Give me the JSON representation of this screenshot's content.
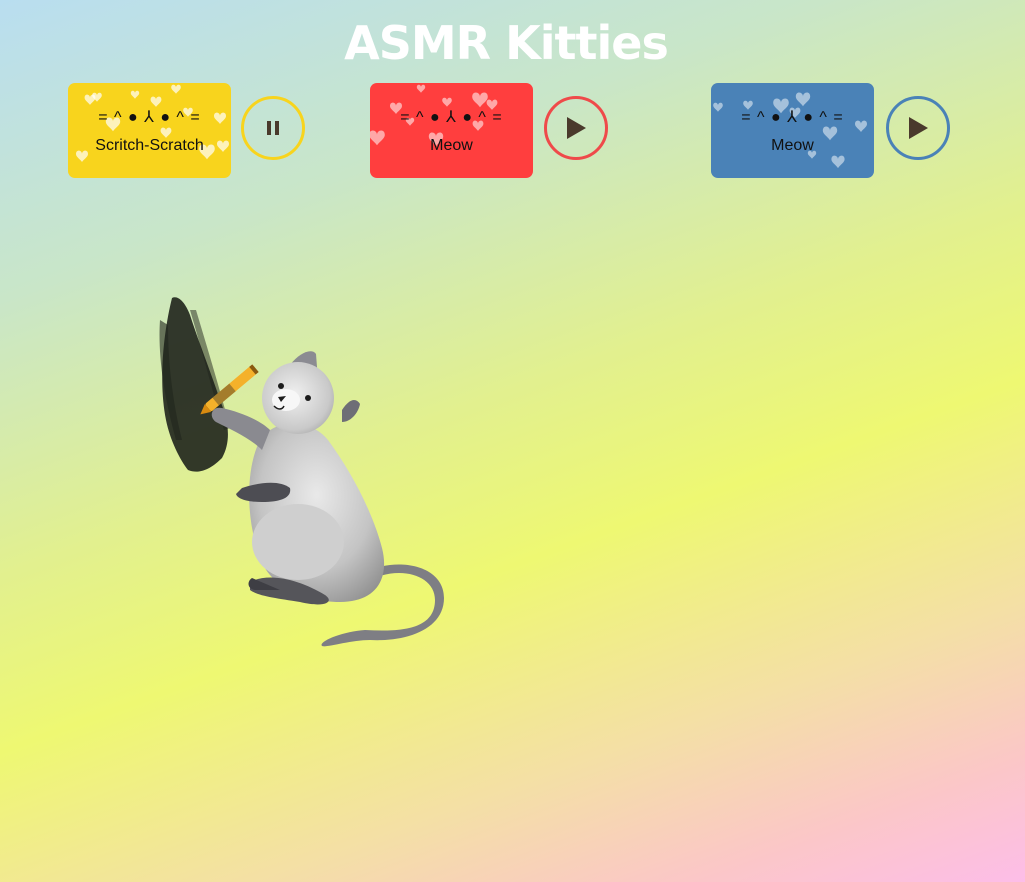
{
  "page": {
    "title": "ASMR Kitties"
  },
  "colors": {
    "yellow": "#f8d41d",
    "red": "#ff3e3e",
    "blue": "#4a82b7",
    "play_icon": "#4a3a2c",
    "title_text": "#ffffff"
  },
  "sounds": [
    {
      "face": "= ^ ● ⅄ ● ^ =",
      "label": "Scritch-Scratch",
      "button_icon": "pause-icon",
      "state": "playing"
    },
    {
      "face": "= ^ ● ⅄ ● ^ =",
      "label": "Meow",
      "button_icon": "play-icon",
      "state": "stopped"
    },
    {
      "face": "= ^ ● ⅄ ● ^ =",
      "label": "Meow",
      "button_icon": "play-icon",
      "state": "stopped"
    }
  ],
  "illustration": {
    "subject": "gray cat scribbling with a yellow crayon",
    "icon": "cat-drawing-illustration"
  }
}
